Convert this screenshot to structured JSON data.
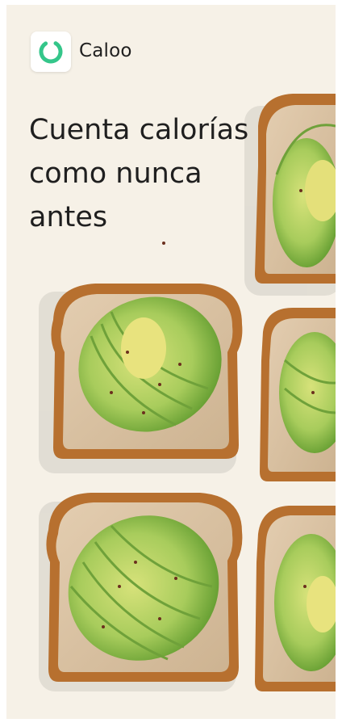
{
  "app": {
    "name": "Caloo",
    "logo_icon": "caloo-ring-logo-icon",
    "accent_color": "#34c68a"
  },
  "hero": {
    "headline": "Cuenta calorías como nunca antes",
    "image": "avocado-toast-photo"
  },
  "colors": {
    "background": "#f6f1e7",
    "avocado": "#9cc55a",
    "toast_crust": "#b7702f"
  }
}
